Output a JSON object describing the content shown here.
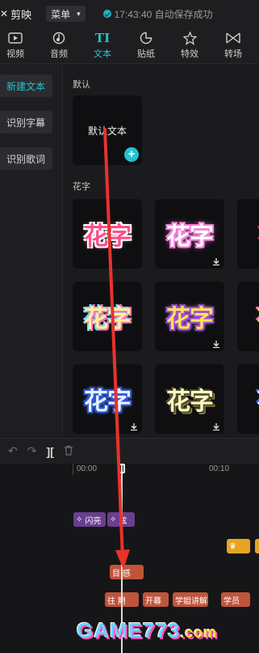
{
  "topbar": {
    "app_name": "剪映",
    "menu_label": "菜单",
    "status_text": "17:43:40 自动保存成功"
  },
  "tools": [
    {
      "label": "视频",
      "icon": "video-icon"
    },
    {
      "label": "音频",
      "icon": "audio-icon"
    },
    {
      "label": "文本",
      "icon": "text-icon",
      "active": true
    },
    {
      "label": "贴纸",
      "icon": "sticker-icon"
    },
    {
      "label": "特效",
      "icon": "effects-icon"
    },
    {
      "label": "转场",
      "icon": "transition-icon"
    }
  ],
  "sidebar": {
    "items": [
      {
        "label": "新建文本",
        "active": true
      },
      {
        "label": "识别字幕"
      },
      {
        "label": "识别歌词"
      }
    ]
  },
  "panel": {
    "default_section": "默认",
    "default_card_text": "默认文本",
    "flower_section": "花字",
    "flower_glyph": "花字"
  },
  "timeline": {
    "tick_start": "00:00",
    "tick_next": "00:10",
    "clips": {
      "purple_1": "闪亮",
      "purple_2": "炫",
      "orange_main": "目 感",
      "orange_a": "往 期",
      "orange_b": "开幕",
      "orange_c": "学姐讲解",
      "orange_d": "学员"
    }
  },
  "watermark": {
    "main": "GAME773",
    "suffix": ".com"
  },
  "colors": {
    "accent": "#22c3d2",
    "arrow": "#e8322b",
    "clip_purple": "#6a3f8e",
    "clip_orange": "#c0543b"
  }
}
